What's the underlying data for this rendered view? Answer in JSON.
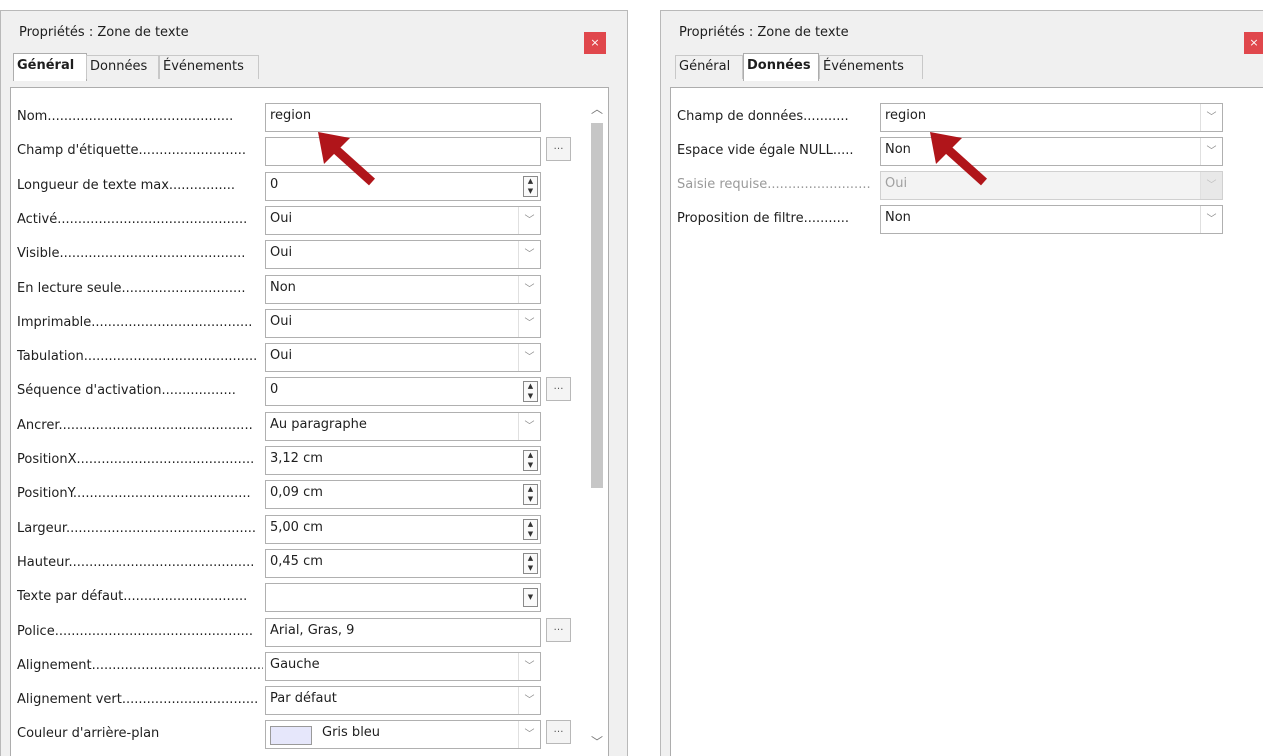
{
  "left_panel": {
    "title": "Propriétés : Zone de texte",
    "close": "×",
    "tabs": [
      {
        "label": "Général",
        "active": true
      },
      {
        "label": "Données",
        "active": false
      },
      {
        "label": "Événements",
        "active": false
      }
    ],
    "rows": [
      {
        "label": "Nom.............................................",
        "value": "region",
        "control": "text"
      },
      {
        "label": "Champ d'étiquette..........................",
        "value": "",
        "control": "text",
        "extra": "…"
      },
      {
        "label": "Longueur de texte max................",
        "value": "0",
        "control": "spin"
      },
      {
        "label": "Activé..............................................",
        "value": "Oui",
        "control": "dropdown"
      },
      {
        "label": "Visible.............................................",
        "value": "Oui",
        "control": "dropdown"
      },
      {
        "label": "En lecture seule..............................",
        "value": "Non",
        "control": "dropdown"
      },
      {
        "label": "Imprimable.......................................",
        "value": "Oui",
        "control": "dropdown"
      },
      {
        "label": "Tabulation..........................................",
        "value": "Oui",
        "control": "dropdown"
      },
      {
        "label": "Séquence d'activation..................",
        "value": "0",
        "control": "spin",
        "extra": "…"
      },
      {
        "label": "Ancrer...............................................",
        "value": "Au paragraphe",
        "control": "dropdown"
      },
      {
        "label": "PositionX...........................................",
        "value": "3,12 cm",
        "control": "spin"
      },
      {
        "label": "PositionY...........................................",
        "value": "0,09 cm",
        "control": "spin"
      },
      {
        "label": "Largeur..............................................",
        "value": "5,00 cm",
        "control": "spin"
      },
      {
        "label": "Hauteur.............................................",
        "value": "0,45 cm",
        "control": "spin"
      },
      {
        "label": "Texte par défaut..............................",
        "value": "",
        "control": "combo"
      },
      {
        "label": "Police................................................",
        "value": "Arial, Gras, 9",
        "control": "text",
        "extra": "…"
      },
      {
        "label": "Alignement..........................................",
        "value": "Gauche",
        "control": "dropdown"
      },
      {
        "label": "Alignement vert.................................",
        "value": "Par défaut",
        "control": "dropdown"
      },
      {
        "label": "Couleur d'arrière-plan",
        "value": "Gris bleu",
        "control": "color",
        "extra": "…"
      }
    ]
  },
  "right_panel": {
    "title": "Propriétés : Zone de texte",
    "close": "×",
    "tabs": [
      {
        "label": "Général",
        "active": false
      },
      {
        "label": "Données",
        "active": true
      },
      {
        "label": "Événements",
        "active": false
      }
    ],
    "rows": [
      {
        "label": "Champ de données...........",
        "value": "region",
        "control": "dropdown",
        "disabled": false
      },
      {
        "label": "Espace vide égale NULL.....",
        "value": "Non",
        "control": "dropdown",
        "disabled": false
      },
      {
        "label": "Saisie requise.........................",
        "value": "Oui",
        "control": "dropdown",
        "disabled": true
      },
      {
        "label": "Proposition de filtre...........",
        "value": "Non",
        "control": "dropdown",
        "disabled": false
      }
    ]
  },
  "colors": {
    "close_button": "#e0474c",
    "arrow": "#b0151a",
    "swatch": "#e6e7fb"
  }
}
